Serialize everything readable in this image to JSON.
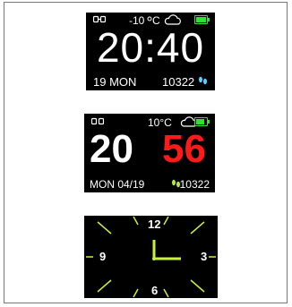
{
  "face_digital_1": {
    "temperature": "-10",
    "temp_unit": "C",
    "time": "20:40",
    "date": "19 MON",
    "steps": "10322"
  },
  "face_digital_2": {
    "temperature": "10°C",
    "hours": "20",
    "minutes": "56",
    "date": "MON 04/19",
    "steps": "10322"
  },
  "face_analog": {
    "numeral_12": "12",
    "numeral_3": "3",
    "numeral_6": "6",
    "numeral_9": "9"
  },
  "colors": {
    "accent_green": "#2ee52e",
    "minutes_red": "#ff1a1a",
    "hand_green": "#c8f03c",
    "tick_green": "#c8f03c"
  },
  "icons": [
    "link-icon",
    "cloud-icon",
    "battery-icon",
    "footprints-icon"
  ]
}
